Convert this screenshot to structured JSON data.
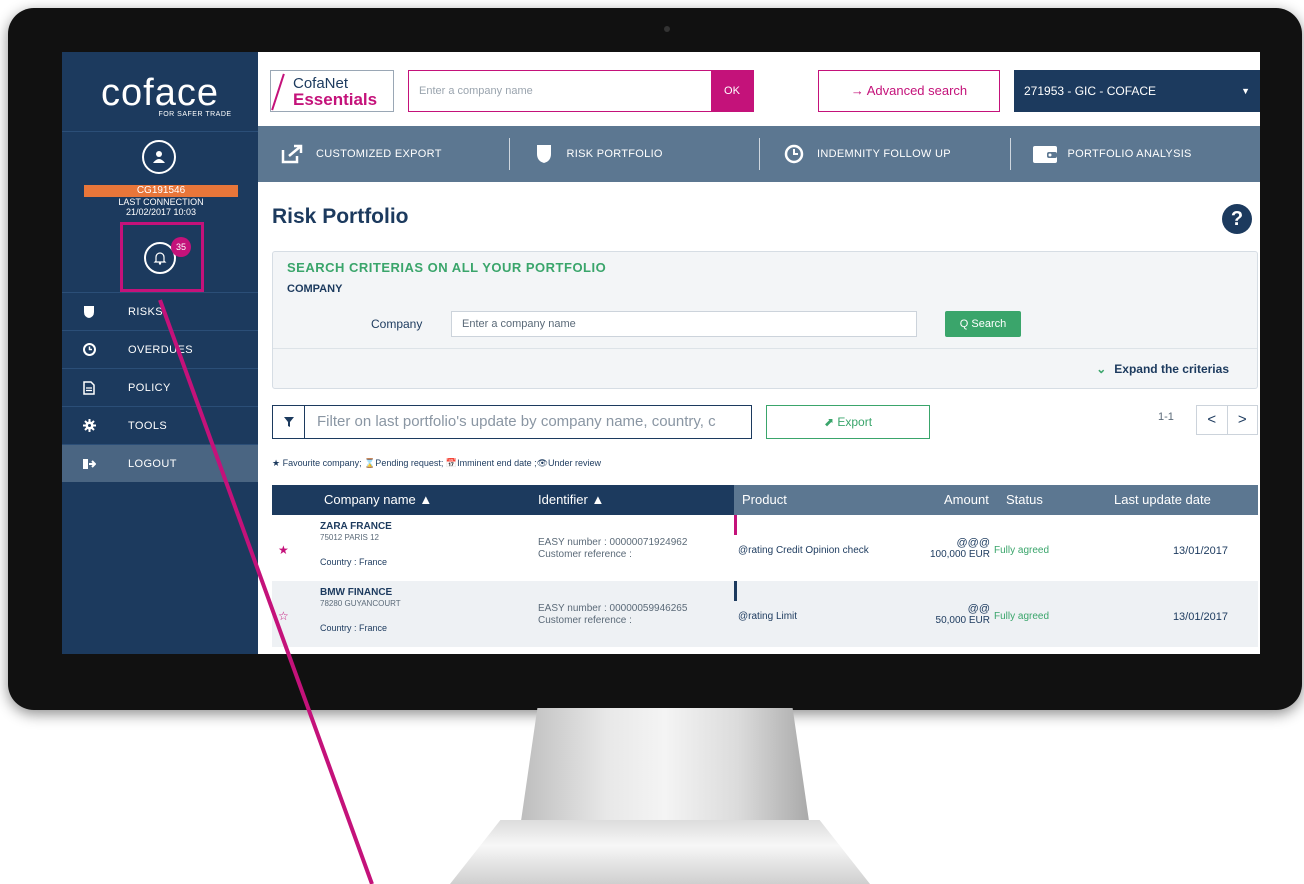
{
  "sidebar": {
    "logo": "coface",
    "tagline": "FOR SAFER TRADE",
    "user_id": "CG191546",
    "last_connection_label": "LAST CONNECTION",
    "last_connection": "21/02/2017 10:03",
    "notifications": "35",
    "menu": [
      {
        "label": "RISKS",
        "icon": "shield-icon"
      },
      {
        "label": "OVERDUES",
        "icon": "clock-icon"
      },
      {
        "label": "POLICY",
        "icon": "document-icon"
      },
      {
        "label": "TOOLS",
        "icon": "gear-icon"
      },
      {
        "label": "LOGOUT",
        "icon": "logout-icon"
      }
    ]
  },
  "topbar": {
    "brand_line1": "CofaNet",
    "brand_line2": "Essentials",
    "search_placeholder": "Enter a company name",
    "ok_label": "OK",
    "advanced_search": "→ Advanced search",
    "account": "271953 - GIC - COFACE"
  },
  "nav": [
    {
      "label": "CUSTOMIZED EXPORT",
      "icon": "export-icon"
    },
    {
      "label": "RISK PORTFOLIO",
      "icon": "shield-icon"
    },
    {
      "label": "INDEMNITY FOLLOW UP",
      "icon": "clock-icon"
    },
    {
      "label": "PORTFOLIO ANALYSIS",
      "icon": "wallet-icon"
    }
  ],
  "page": {
    "title": "Risk Portfolio",
    "help": "?"
  },
  "criteria": {
    "title": "SEARCH CRITERIAS ON ALL YOUR PORTFOLIO",
    "section": "COMPANY",
    "company_label": "Company",
    "company_placeholder": "Enter a company name",
    "search_button": "Q Search",
    "expand": "Expand the criterias"
  },
  "toolbar": {
    "filter_placeholder": "Filter on last portfolio's update by company name, country, c",
    "export_label": "Export",
    "pager_count": "1-1",
    "prev": "<",
    "next": ">"
  },
  "legend": "★ Favourite company; ⌛Pending request; 📅Imminent end date ;👁Under review",
  "table": {
    "columns": [
      "Company name ▲",
      "Identifier ▲",
      "Product",
      "Amount",
      "Status",
      "Last update date"
    ],
    "rows": [
      {
        "favourite": "★",
        "name": "ZARA FRANCE",
        "address": "75012 PARIS 12",
        "country": "Country : France",
        "easy_number": "EASY number : 00000071924962",
        "customer_ref": "Customer reference :",
        "product": "@rating Credit Opinion check",
        "rating": "@@@",
        "amount": "100,000 EUR",
        "status": "Fully agreed",
        "date": "13/01/2017",
        "bar_color": "#c4127a"
      },
      {
        "favourite": "☆",
        "name": "BMW FINANCE",
        "address": "78280 GUYANCOURT",
        "country": "Country : France",
        "easy_number": "EASY number : 00000059946265",
        "customer_ref": "Customer reference :",
        "product": "@rating Limit",
        "rating": "@@",
        "amount": "50,000 EUR",
        "status": "Fully agreed",
        "date": "13/01/2017",
        "bar_color": "#1c3a5e"
      }
    ]
  },
  "colors": {
    "navy": "#1c3a5e",
    "magenta": "#c4127a",
    "green": "#3aa56b",
    "orange": "#e8763a",
    "slate": "#5c7791"
  }
}
